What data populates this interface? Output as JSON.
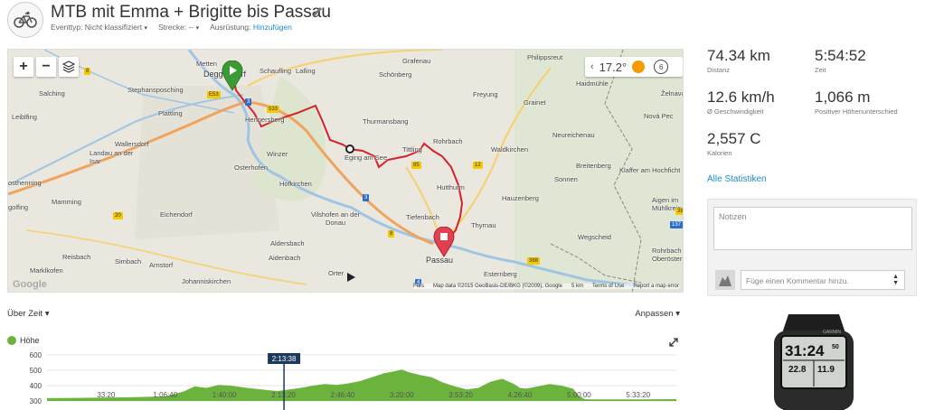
{
  "header": {
    "title": "MTB mit Emma + Brigitte bis Passau",
    "event_type_label": "Eventtyp: Nicht klassifiziert",
    "course_label": "Strecke: --",
    "equipment_label": "Ausrüstung:",
    "equipment_link": "Hinzufügen"
  },
  "map": {
    "weather_temp": "17.2°",
    "wind_value": "6",
    "footer": [
      "Fürs",
      "Map data ©2015 GeoBasis-DE/BKG (©2009), Google",
      "5 km",
      "Terms of Use",
      "Report a map error"
    ],
    "google_logo": "Google",
    "labels": [
      {
        "text": "Metten"
      },
      {
        "text": "Deggendorf"
      },
      {
        "text": "Schaufling"
      },
      {
        "text": "Lalling"
      },
      {
        "text": "Grafenau"
      },
      {
        "text": "Philippsreut"
      },
      {
        "text": "Schönberg"
      },
      {
        "text": "Haidmühle"
      },
      {
        "text": "Želnava"
      },
      {
        "text": "Stephansposching"
      },
      {
        "text": "Salching"
      },
      {
        "text": "Freyung"
      },
      {
        "text": "Grainet"
      },
      {
        "text": "Leiblfing"
      },
      {
        "text": "Plattling"
      },
      {
        "text": "Hengersberg"
      },
      {
        "text": "Thurmansbang"
      },
      {
        "text": "Nová Pec"
      },
      {
        "text": "Neureichenau"
      },
      {
        "text": "Rohrbach"
      },
      {
        "text": "Wallersdorf"
      },
      {
        "text": "Eging am See"
      },
      {
        "text": "Tittling"
      },
      {
        "text": "Waldkirchen"
      },
      {
        "text": "Winzer"
      },
      {
        "text": "Breitenberg"
      },
      {
        "text": "Klaffer am Hochficht"
      },
      {
        "text": "Osterhofen"
      },
      {
        "text": "Landau an der Isar"
      },
      {
        "text": "Hutthurm"
      },
      {
        "text": "Sonnen"
      },
      {
        "text": "osthenning"
      },
      {
        "text": "Hofkirchen"
      },
      {
        "text": "Hauzenberg"
      },
      {
        "text": "Mamming"
      },
      {
        "text": "Eichendorf"
      },
      {
        "text": "Vilshofen an der Donau"
      },
      {
        "text": "Tiefenbach"
      },
      {
        "text": "Thyrnau"
      },
      {
        "text": "Aigen im Mühlkreis"
      },
      {
        "text": "golfing"
      },
      {
        "text": "Passau"
      },
      {
        "text": "Wegscheid"
      },
      {
        "text": "Aldersbach"
      },
      {
        "text": "Aidenbach"
      },
      {
        "text": "Reisbach"
      },
      {
        "text": "Simbach"
      },
      {
        "text": "Arnstorf"
      },
      {
        "text": "Esternberg"
      },
      {
        "text": "Rohrbach Oberösterreich"
      },
      {
        "text": "Marklkofen"
      },
      {
        "text": "Johanniskirchen"
      },
      {
        "text": "Orter"
      }
    ],
    "roads": [
      {
        "text": "8"
      },
      {
        "text": "E53"
      },
      {
        "text": "533"
      },
      {
        "text": "3"
      },
      {
        "text": "85"
      },
      {
        "text": "12"
      },
      {
        "text": "20"
      },
      {
        "text": "3"
      },
      {
        "text": "8"
      },
      {
        "text": "388"
      },
      {
        "text": "4"
      },
      {
        "text": "137"
      },
      {
        "text": "38"
      }
    ]
  },
  "stats": {
    "items": [
      {
        "value": "74.34 km",
        "label": "Distanz"
      },
      {
        "value": "5:54:52",
        "label": "Zeit"
      },
      {
        "value": "12.6 km/h",
        "label": "Ø Geschwindigkeit"
      },
      {
        "value": "1,066 m",
        "label": "Positiver Höhenunterschied"
      },
      {
        "value": "2,557 C",
        "label": "Kalorien"
      }
    ],
    "all_stats_link": "Alle Statistiken"
  },
  "notes": {
    "placeholder": "Notizen",
    "comment_placeholder": "Füge einen Kommentar hinzu."
  },
  "device": {
    "brand": "GARMIN",
    "time_main": "31:24",
    "time_sec": "50",
    "val1": "22.8",
    "val2": "11.9"
  },
  "chart_header": {
    "mode": "Über Zeit",
    "fit": "Anpassen"
  },
  "chart_data": {
    "type": "area",
    "title": "",
    "series_name": "Höhe",
    "ylim": [
      300,
      600
    ],
    "yticks": [
      "600",
      "500",
      "400",
      "300"
    ],
    "xtick_labels": [
      "33:20",
      "1:06:40",
      "1:40:00",
      "2:13:20",
      "2:46:40",
      "3:20:00",
      "3:53:20",
      "4:26:40",
      "5:00:00",
      "5:33:20"
    ],
    "xtick_seconds": [
      2000,
      4000,
      6000,
      8000,
      10000,
      12000,
      14000,
      16000,
      18000,
      20000
    ],
    "cursor_label": "2:13:38",
    "cursor_seconds": 8018,
    "x_max_seconds": 21292,
    "x_seconds": [
      0,
      1000,
      2000,
      3000,
      4000,
      4600,
      5000,
      5400,
      5800,
      6200,
      6600,
      7000,
      7400,
      7800,
      8200,
      8600,
      9000,
      9400,
      9800,
      10200,
      10600,
      11000,
      11400,
      11800,
      12000,
      12200,
      12600,
      13000,
      13400,
      13800,
      14200,
      14600,
      15000,
      15400,
      15800,
      16000,
      16200,
      16600,
      17000,
      17400,
      17800,
      18000,
      18200,
      18400,
      19000,
      20000,
      21292
    ],
    "elevation_m": [
      318,
      320,
      322,
      325,
      330,
      360,
      395,
      385,
      405,
      400,
      390,
      380,
      372,
      365,
      375,
      385,
      400,
      410,
      405,
      415,
      430,
      455,
      480,
      495,
      505,
      490,
      470,
      455,
      420,
      395,
      375,
      385,
      425,
      445,
      410,
      385,
      380,
      395,
      410,
      400,
      380,
      330,
      312,
      310,
      310,
      310,
      312
    ]
  }
}
